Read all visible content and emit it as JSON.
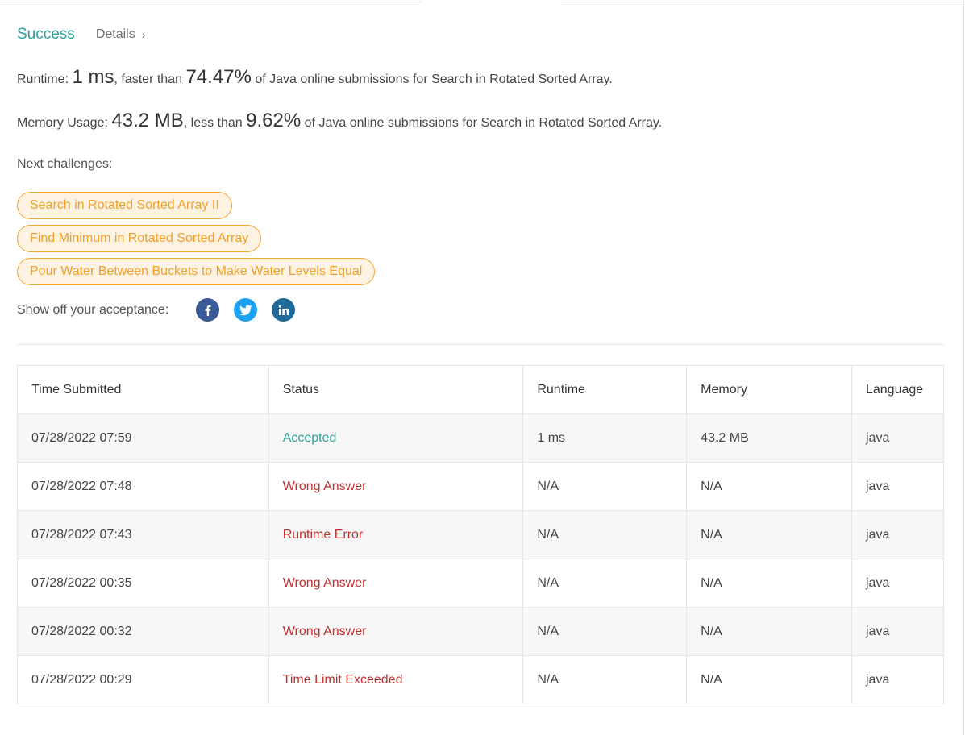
{
  "header": {
    "status": "Success",
    "details_label": "Details",
    "details_chevron": "›"
  },
  "runtime": {
    "label": "Runtime:",
    "value": "1 ms",
    "mid": ", faster than",
    "percent": "74.47%",
    "suffix": "of Java online submissions for Search in Rotated Sorted Array."
  },
  "memory": {
    "label": "Memory Usage:",
    "value": "43.2 MB",
    "mid": ", less than",
    "percent": "9.62%",
    "suffix": "of Java online submissions for Search in Rotated Sorted Array."
  },
  "next": {
    "label": "Next challenges:",
    "items": [
      "Search in Rotated Sorted Array II",
      "Find Minimum in Rotated Sorted Array",
      "Pour Water Between Buckets to Make Water Levels Equal"
    ]
  },
  "share": {
    "label": "Show off your acceptance:",
    "icons": [
      "facebook-icon",
      "twitter-icon",
      "linkedin-icon"
    ]
  },
  "table": {
    "headers": [
      "Time Submitted",
      "Status",
      "Runtime",
      "Memory",
      "Language"
    ],
    "rows": [
      [
        "07/28/2022 07:59",
        "Accepted",
        "1 ms",
        "43.2 MB",
        "java"
      ],
      [
        "07/28/2022 07:48",
        "Wrong Answer",
        "N/A",
        "N/A",
        "java"
      ],
      [
        "07/28/2022 07:43",
        "Runtime Error",
        "N/A",
        "N/A",
        "java"
      ],
      [
        "07/28/2022 00:35",
        "Wrong Answer",
        "N/A",
        "N/A",
        "java"
      ],
      [
        "07/28/2022 00:32",
        "Wrong Answer",
        "N/A",
        "N/A",
        "java"
      ],
      [
        "07/28/2022 00:29",
        "Time Limit Exceeded",
        "N/A",
        "N/A",
        "java"
      ]
    ]
  },
  "colors": {
    "success": "#2aa399",
    "error": "#c0302f",
    "chip_border": "#f4a733",
    "chip_text": "#f0a02a"
  }
}
